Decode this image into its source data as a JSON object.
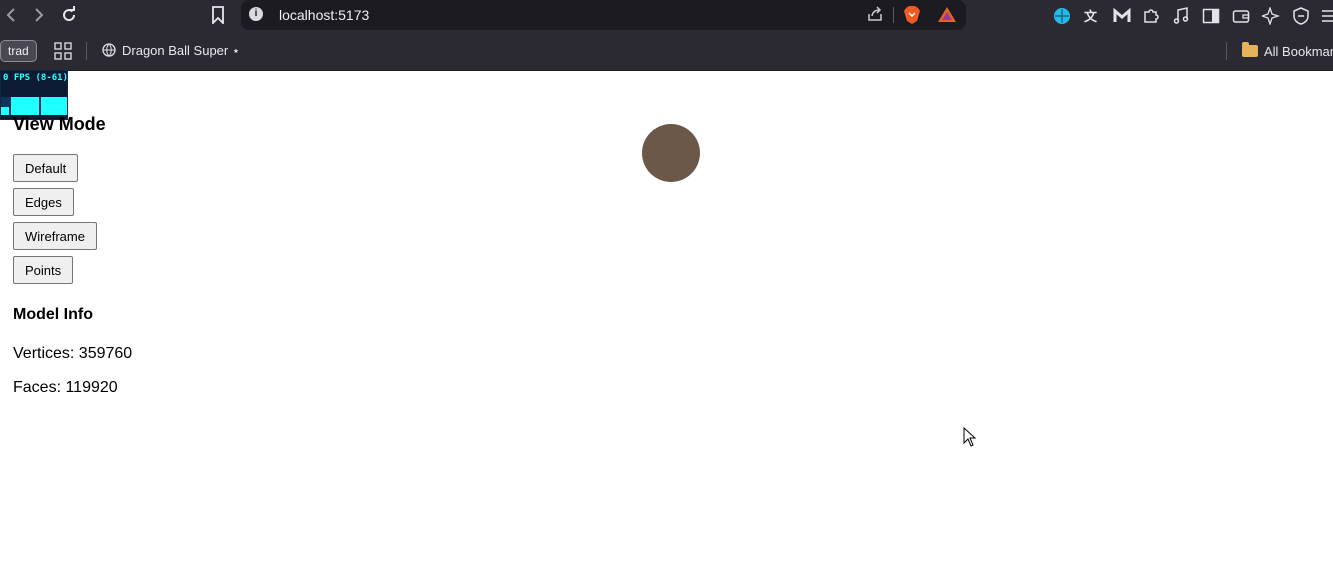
{
  "browser": {
    "url": "localhost:5173",
    "bookmarks": {
      "trad_label": "trad",
      "tab_title": "Dragon Ball Super ⋆",
      "all_bookmarks_label": "All Bookmarks"
    },
    "icons": [
      "back-icon",
      "forward-icon",
      "reload-icon",
      "bookmark-icon",
      "info-icon",
      "share-icon",
      "brave-shields-icon",
      "brave-rewards-icon",
      "extension-icons",
      "puzzle-icon",
      "music-icon",
      "sidebar-icon",
      "wallet-icon",
      "leo-ai-icon",
      "vpn-icon",
      "menu-icon"
    ]
  },
  "stats": {
    "fps_label": "0 FPS (8-61)"
  },
  "view_mode": {
    "title": "View Mode",
    "buttons": [
      "Default",
      "Edges",
      "Wireframe",
      "Points"
    ]
  },
  "model_info": {
    "title": "Model Info",
    "vertices": "Vertices: 359760",
    "faces": "Faces: 119920"
  },
  "colors": {
    "model": "#6b5848",
    "chrome_bg": "#2b2a33",
    "stats_text": "#30ffff"
  }
}
